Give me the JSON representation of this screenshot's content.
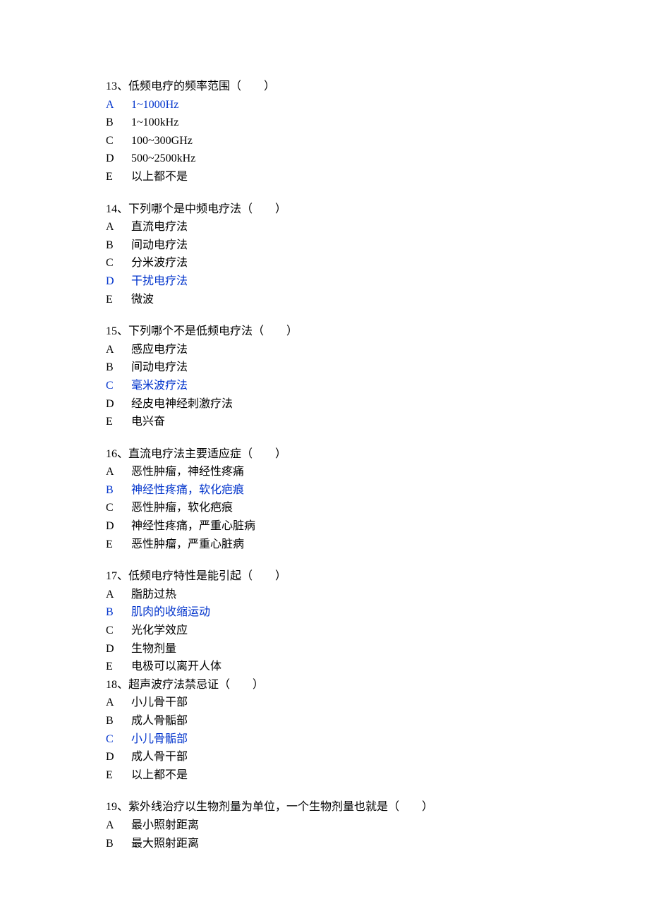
{
  "questions": [
    {
      "id": "q13",
      "stem": "13、低频电疗的频率范围（　　）",
      "highlight_index": 0,
      "options": [
        {
          "letter": "A",
          "text": "1~1000Hz"
        },
        {
          "letter": "B",
          "text": "1~100kHz"
        },
        {
          "letter": "C",
          "text": "100~300GHz"
        },
        {
          "letter": "D",
          "text": "500~2500kHz"
        },
        {
          "letter": "E",
          "text": "以上都不是"
        }
      ]
    },
    {
      "id": "q14",
      "stem": "14、下列哪个是中频电疗法（　　）",
      "highlight_index": 3,
      "options": [
        {
          "letter": "A",
          "text": "直流电疗法"
        },
        {
          "letter": "B",
          "text": "间动电疗法"
        },
        {
          "letter": "C",
          "text": "分米波疗法"
        },
        {
          "letter": "D",
          "text": "干扰电疗法"
        },
        {
          "letter": "E",
          "text": "微波"
        }
      ]
    },
    {
      "id": "q15",
      "stem": "15、下列哪个不是低频电疗法（　　）",
      "highlight_index": 2,
      "options": [
        {
          "letter": "A",
          "text": "感应电疗法"
        },
        {
          "letter": "B",
          "text": "间动电疗法"
        },
        {
          "letter": "C",
          "text": "毫米波疗法"
        },
        {
          "letter": "D",
          "text": "经皮电神经刺激疗法"
        },
        {
          "letter": "E",
          "text": "电兴奋"
        }
      ]
    },
    {
      "id": "q16",
      "stem": "16、直流电疗法主要适应症（　　）",
      "highlight_index": 1,
      "options": [
        {
          "letter": "A",
          "text": "恶性肿瘤，神经性疼痛"
        },
        {
          "letter": "B",
          "text": "神经性疼痛，软化疤痕"
        },
        {
          "letter": "C",
          "text": "恶性肿瘤，软化疤痕"
        },
        {
          "letter": "D",
          "text": "神经性疼痛，严重心脏病"
        },
        {
          "letter": "E",
          "text": "恶性肿瘤，严重心脏病"
        }
      ]
    },
    {
      "id": "q17",
      "stem": "17、低频电疗特性是能引起（　　）",
      "highlight_index": 1,
      "tight": true,
      "options": [
        {
          "letter": "A",
          "text": "脂肪过热"
        },
        {
          "letter": "B",
          "text": "肌肉的收缩运动"
        },
        {
          "letter": "C",
          "text": "光化学效应"
        },
        {
          "letter": "D",
          "text": "生物剂量"
        },
        {
          "letter": "E",
          "text": "电极可以离开人体"
        }
      ]
    },
    {
      "id": "q18",
      "stem": "18、超声波疗法禁忌证（　　）",
      "highlight_index": 2,
      "options": [
        {
          "letter": "A",
          "text": "小儿骨干部"
        },
        {
          "letter": "B",
          "text": "成人骨骺部"
        },
        {
          "letter": "C",
          "text": "小儿骨骺部"
        },
        {
          "letter": "D",
          "text": "成人骨干部"
        },
        {
          "letter": "E",
          "text": "以上都不是"
        }
      ]
    },
    {
      "id": "q19",
      "stem": "19、紫外线治疗以生物剂量为单位，一个生物剂量也就是（　　）",
      "highlight_index": -1,
      "options": [
        {
          "letter": "A",
          "text": "最小照射距离"
        },
        {
          "letter": "B",
          "text": "最大照射距离"
        }
      ]
    }
  ]
}
